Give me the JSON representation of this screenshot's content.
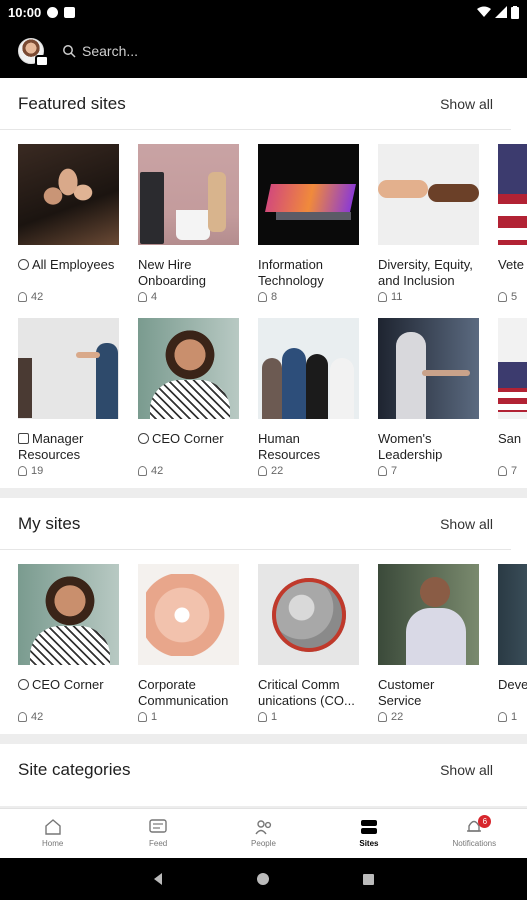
{
  "status_bar": {
    "time": "10:00"
  },
  "header": {
    "search_placeholder": "Search..."
  },
  "featured": {
    "title": "Featured sites",
    "show_all": "Show all",
    "row1": [
      {
        "name": "All Employees",
        "members": "42",
        "icon": "verified"
      },
      {
        "name": "New Hire Onboarding",
        "members": "4",
        "icon": ""
      },
      {
        "name": "Information Technology",
        "members": "8",
        "icon": ""
      },
      {
        "name": "Diversity, Equity, and Inclusion",
        "members": "11",
        "icon": ""
      },
      {
        "name": "Vete",
        "members": "5",
        "icon": ""
      }
    ],
    "row2": [
      {
        "name": "Manager Resources",
        "members": "19",
        "icon": "lock"
      },
      {
        "name": "CEO Corner",
        "members": "42",
        "icon": "verified"
      },
      {
        "name": "Human Resources",
        "members": "22",
        "icon": ""
      },
      {
        "name": "Women's Leadership",
        "members": "7",
        "icon": ""
      },
      {
        "name": "San",
        "members": "7",
        "icon": ""
      }
    ]
  },
  "my_sites": {
    "title": "My sites",
    "show_all": "Show all",
    "items": [
      {
        "name": "CEO Corner",
        "members": "42",
        "icon": "verified"
      },
      {
        "name": "Corporate Communication",
        "members": "1",
        "icon": ""
      },
      {
        "name": "Critical Comm unications (CO...",
        "members": "1",
        "icon": ""
      },
      {
        "name": "Customer Service",
        "members": "22",
        "icon": ""
      },
      {
        "name": "Deve Reso",
        "members": "1",
        "icon": ""
      }
    ]
  },
  "categories": {
    "title": "Site categories",
    "show_all": "Show all"
  },
  "nav": {
    "items": [
      {
        "label": "Home",
        "icon": "home-icon"
      },
      {
        "label": "Feed",
        "icon": "feed-icon"
      },
      {
        "label": "People",
        "icon": "people-icon"
      },
      {
        "label": "Sites",
        "icon": "sites-icon"
      },
      {
        "label": "Notifications",
        "icon": "bell-icon"
      }
    ],
    "active": "Sites",
    "notification_count": "6"
  },
  "colors": {
    "accent": "#d7262d",
    "background": "#ededed"
  }
}
